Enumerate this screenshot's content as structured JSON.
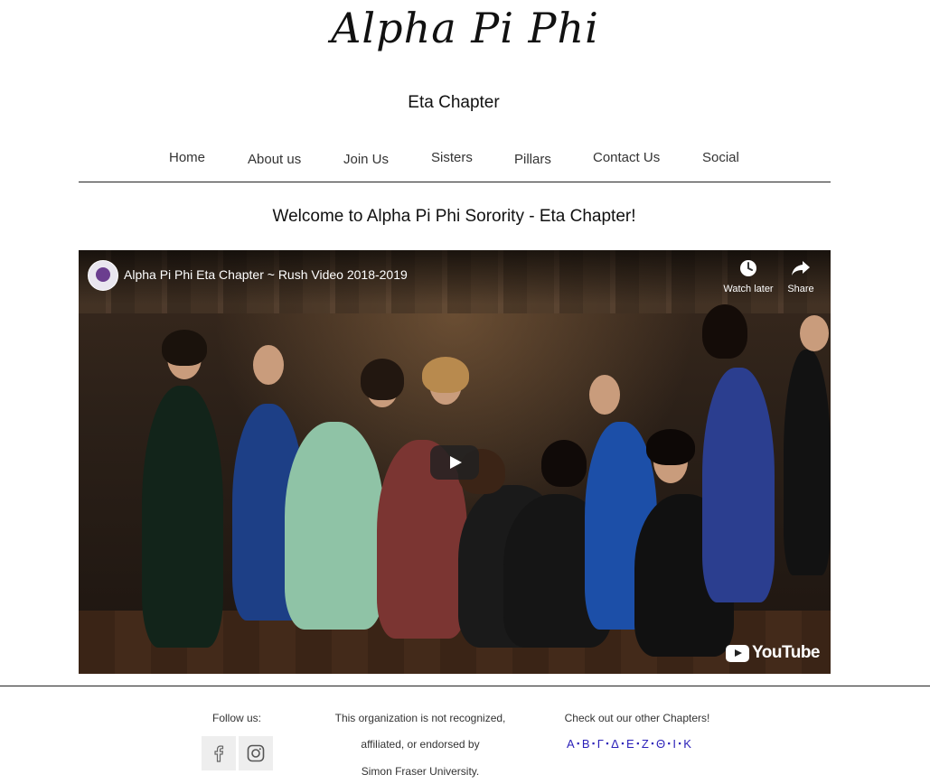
{
  "header": {
    "logo_text": "Alpha Pi Phi",
    "subtitle": "Eta Chapter"
  },
  "nav": {
    "items": [
      {
        "label": "Home"
      },
      {
        "label": "About us"
      },
      {
        "label": "Join Us"
      },
      {
        "label": "Sisters"
      },
      {
        "label": "Pillars"
      },
      {
        "label": "Contact Us"
      },
      {
        "label": "Social"
      }
    ]
  },
  "main": {
    "welcome": "Welcome to Alpha Pi Phi Sorority - Eta Chapter!"
  },
  "video": {
    "title": "Alpha Pi Phi Eta Chapter ~ Rush Video 2018-2019",
    "watch_later_label": "Watch later",
    "share_label": "Share",
    "youtube_label": "YouTube",
    "icons": {
      "channel": "channel-avatar-icon",
      "watch_later": "clock-icon",
      "share": "share-arrow-icon",
      "play": "play-icon",
      "logo": "youtube-logo-icon"
    }
  },
  "footer": {
    "follow_label": "Follow us:",
    "social_icons": [
      "facebook-icon",
      "instagram-icon"
    ],
    "disclaimer_lines": [
      "This organization is not recognized,",
      "affiliated, or endorsed by",
      "Simon Fraser University."
    ],
    "chapters_label": "Check out our other Chapters!",
    "chapters": [
      "Α",
      "Β",
      "Γ",
      "Δ",
      "Ε",
      "Ζ",
      "Θ",
      "Ι",
      "Κ"
    ],
    "chapter_separator": "▪",
    "colors": {
      "chapter_link": "#2a1fb8",
      "divider": "#222222"
    }
  }
}
